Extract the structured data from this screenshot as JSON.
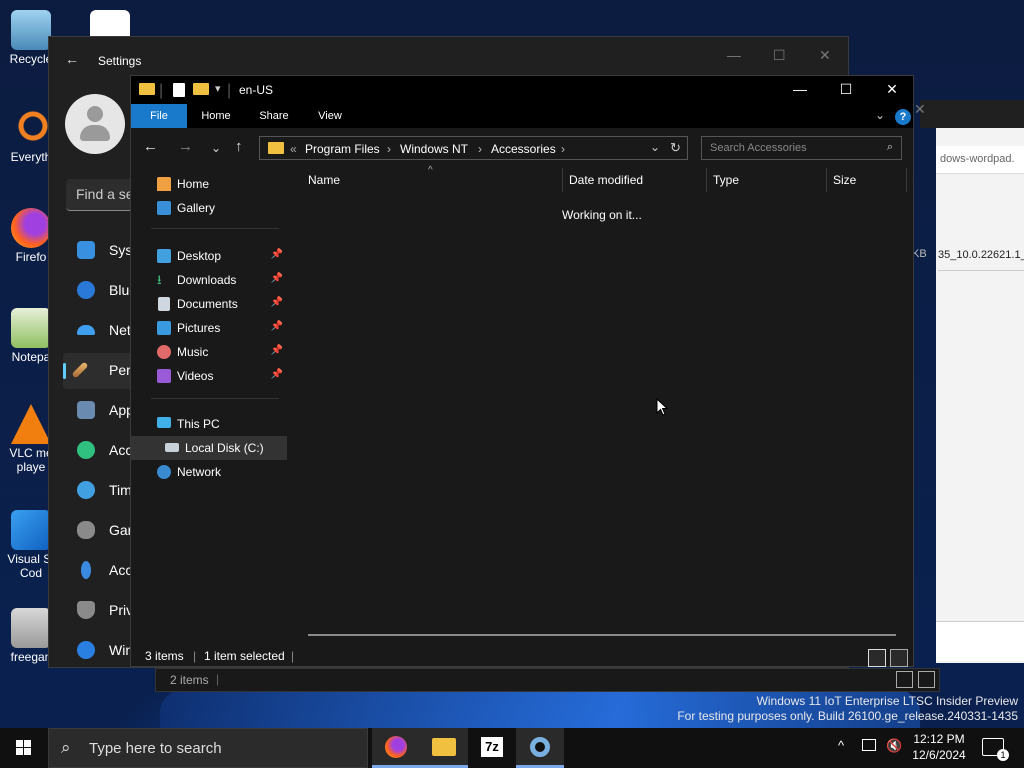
{
  "desktop_icons": [
    {
      "label": "Recycle",
      "icon": "recycle-bin-icon"
    },
    {
      "label": "Everyth",
      "icon": "everything-search-icon"
    },
    {
      "label": "Firefo",
      "icon": "firefox-icon"
    },
    {
      "label": "Notepa",
      "icon": "notepad-plus-icon"
    },
    {
      "label": "VLC me playe",
      "icon": "vlc-icon"
    },
    {
      "label": "Visual St Cod",
      "icon": "vscode-icon"
    },
    {
      "label": "freegan",
      "icon": "freegan-icon"
    }
  ],
  "settings": {
    "title": "Settings",
    "search_placeholder": "Find a se",
    "nav": [
      "Syst",
      "Blue",
      "Net",
      "Pers",
      "App",
      "Acc",
      "Tim",
      "Gar",
      "Acc",
      "Priv",
      "Win"
    ]
  },
  "bg_window": {
    "title_fragment": "dows-wordpad.",
    "size_fragment": "KB",
    "file_fragment": "35_10.0.22621.1_"
  },
  "explorer": {
    "title": "en-US",
    "ribbon_tabs": [
      "File",
      "Home",
      "Share",
      "View"
    ],
    "address": {
      "overflow": "«",
      "crumbs": [
        "Program Files",
        "Windows NT",
        "Accessories"
      ]
    },
    "search_placeholder": "Search Accessories",
    "nav_pane": {
      "quick": [
        "Home",
        "Gallery"
      ],
      "pinned": [
        "Desktop",
        "Downloads",
        "Documents",
        "Pictures",
        "Music",
        "Videos"
      ],
      "this_pc": "This PC",
      "local_disk": "Local Disk (C:)",
      "network": "Network"
    },
    "columns": [
      "Name",
      "Date modified",
      "Type",
      "Size"
    ],
    "status_message": "Working on it...",
    "status_bar": {
      "items": "3 items",
      "selected": "1 item selected"
    }
  },
  "behind_status": {
    "items": "2 items"
  },
  "watermark": {
    "line1": "Windows 11 IoT Enterprise LTSC Insider Preview",
    "line2": "For testing purposes only. Build 26100.ge_release.240331-1435"
  },
  "taskbar": {
    "search_placeholder": "Type here to search",
    "apps": [
      "firefox-icon",
      "file-explorer-icon",
      "7zip-icon",
      "settings-gear-icon"
    ],
    "time": "12:12 PM",
    "date": "12/6/2024",
    "notification_count": "1",
    "seven_zip_label": "7z"
  },
  "colors": {
    "accent": "#1979ca",
    "window_bg": "#191919",
    "taskbar": "#101010"
  }
}
